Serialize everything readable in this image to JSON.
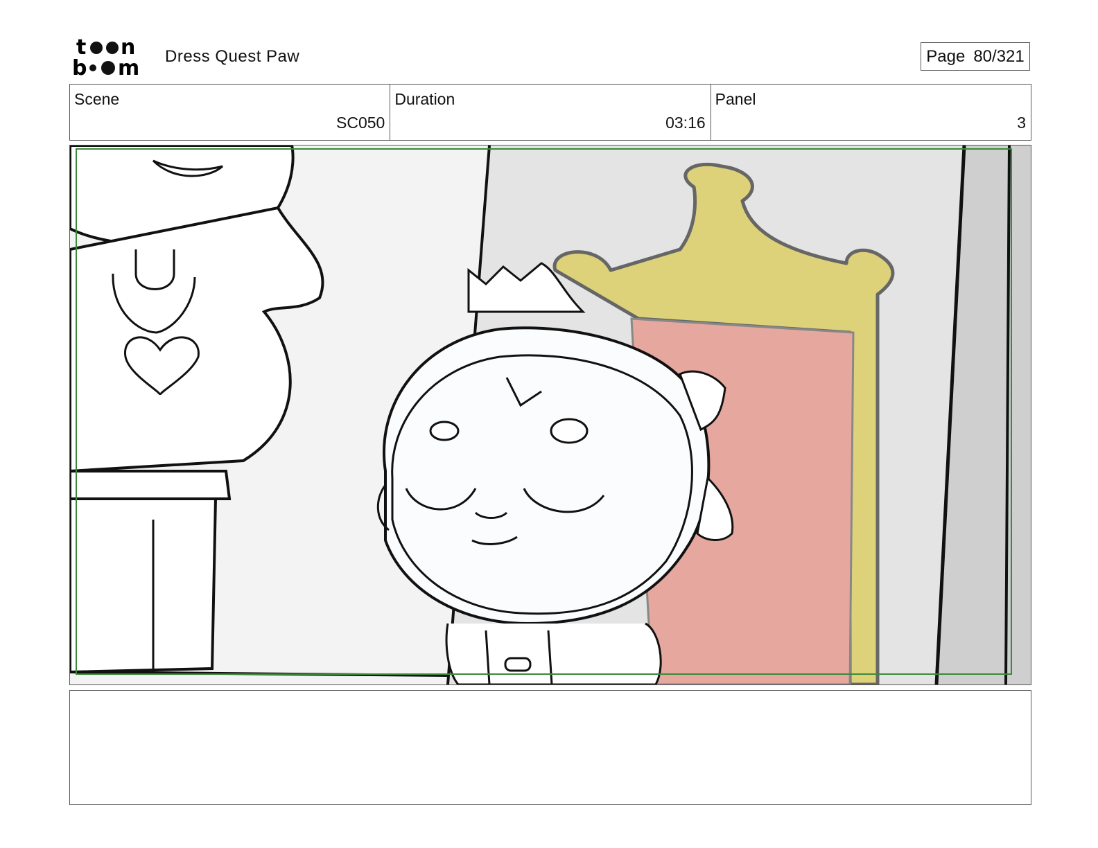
{
  "header": {
    "logo_text_top": "toon",
    "logo_text_bottom": "boom",
    "project_title": "Dress Quest Paw",
    "page_label": "Page",
    "page_value": "80/321"
  },
  "info": {
    "scene_label": "Scene",
    "scene_value": "SC050",
    "duration_label": "Duration",
    "duration_value": "03:16",
    "panel_label": "Panel",
    "panel_value": "3"
  },
  "panel_image": {
    "subject": "storyboard-drawing",
    "colors": {
      "safe_frame": "#3a8a3a",
      "throne_gold": "#ddd27a",
      "throne_cushion": "#e6a89e",
      "wall_light": "#f3f3f3",
      "wall_mid": "#e4e4e4",
      "wall_dark": "#cfcfcf",
      "line": "#111111"
    }
  },
  "notes": {
    "text": ""
  }
}
